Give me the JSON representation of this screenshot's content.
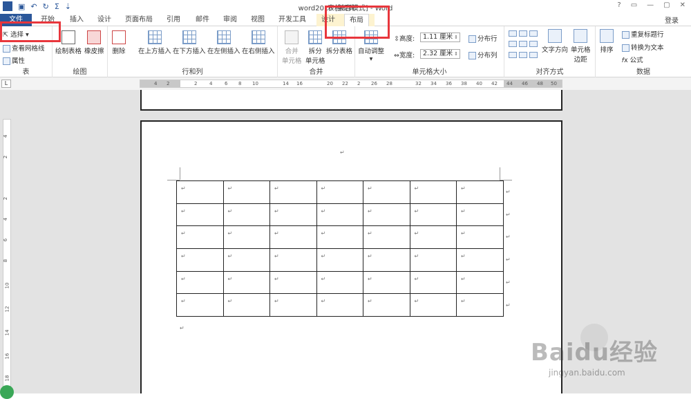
{
  "window": {
    "title": "word2016 [兼容模式] - Word",
    "context_group": "表格工具",
    "login": "登录",
    "controls": [
      "?",
      "▭",
      "—",
      "▢",
      "✕"
    ]
  },
  "qat": {
    "app_icon": "W",
    "save_icon": "save-icon",
    "undo_icon": "undo-icon",
    "redo_icon": "redo-icon",
    "sum": "Σ",
    "more": "⇧"
  },
  "tabs": [
    "文件",
    "开始",
    "插入",
    "设计",
    "页面布局",
    "引用",
    "邮件",
    "审阅",
    "视图",
    "开发工具",
    "设计",
    "布局"
  ],
  "ribbon": {
    "table_group": {
      "label": "表",
      "select": "选择 ▾",
      "gridlines": "查看网格线",
      "properties": "属性"
    },
    "draw_group": {
      "label": "绘图",
      "draw_table": "绘制表格",
      "eraser": "橡皮擦"
    },
    "rows_cols_group": {
      "label": "行和列",
      "delete": "删除",
      "insert_above": "在上方插入",
      "insert_below": "在下方插入",
      "insert_left": "在左侧插入",
      "insert_right": "在右侧插入"
    },
    "merge_group": {
      "label": "合并",
      "merge_cells_1": "合并",
      "merge_cells_2": "单元格",
      "split_cells_1": "拆分",
      "split_cells_2": "单元格",
      "split_table": "拆分表格"
    },
    "cell_size_group": {
      "label": "单元格大小",
      "autofit": "自动调整",
      "height_label": "高度:",
      "height_value": "1.11 厘米",
      "width_label": "宽度:",
      "width_value": "2.32 厘米",
      "distribute_rows": "分布行",
      "distribute_cols": "分布列"
    },
    "align_group": {
      "label": "对齐方式",
      "text_direction": "文字方向",
      "cell_margins_1": "单元格",
      "cell_margins_2": "边距"
    },
    "data_group": {
      "label": "数据",
      "sort": "排序",
      "repeat_header": "重复标题行",
      "convert_text": "转换为文本",
      "formula": "公式"
    }
  },
  "ruler": {
    "corner": "L",
    "numbers": [
      "4",
      "2",
      "2",
      "4",
      "6",
      "8",
      "10",
      "14",
      "16",
      "20",
      "22",
      "2",
      "26",
      "28",
      "32",
      "34",
      "36",
      "38",
      "40",
      "42",
      "44",
      "46",
      "48",
      "50"
    ],
    "vnumbers": [
      "4",
      "2",
      "2",
      "4",
      "6",
      "8",
      "10",
      "12",
      "14",
      "16",
      "18"
    ]
  },
  "document": {
    "rows": 6,
    "cols": 7,
    "cell_mark": "↵",
    "para_mark": "↵"
  },
  "watermark": {
    "brand": "Baidu经验",
    "url": "jingyan.baidu.com"
  },
  "colors": {
    "accent": "#2b579a",
    "highlight": "#e8363c",
    "context_tab_bg": "#fdf3d0"
  }
}
